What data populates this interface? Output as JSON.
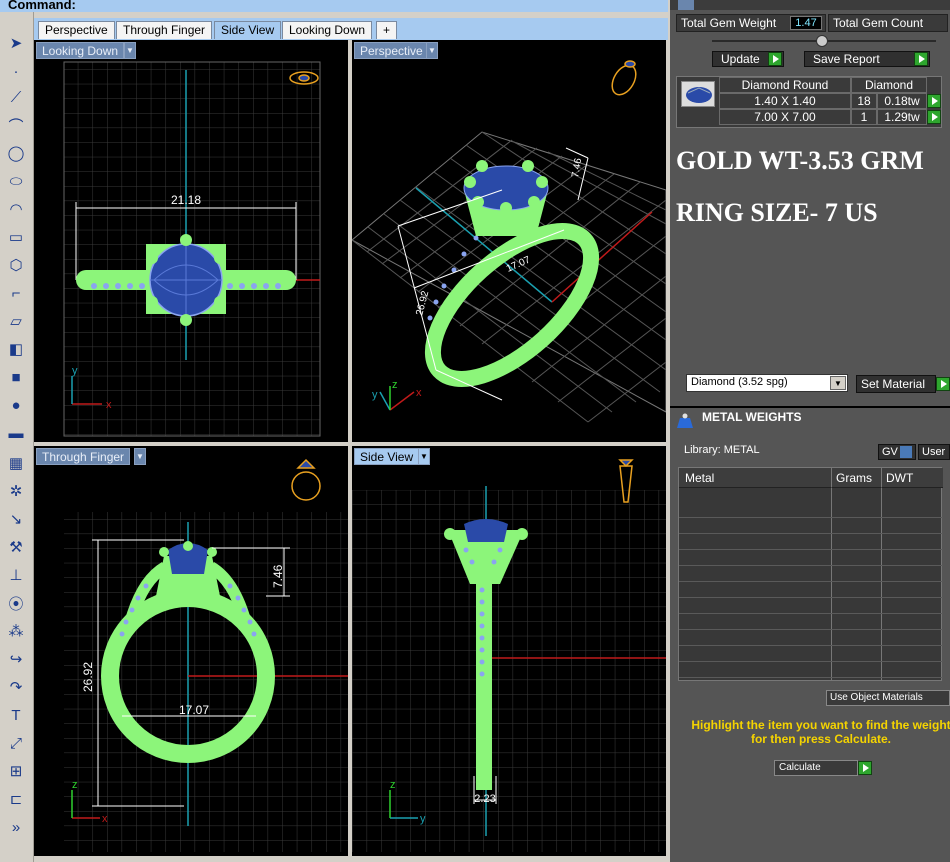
{
  "command": {
    "label": "Command:"
  },
  "tabs": [
    {
      "label": "Perspective"
    },
    {
      "label": "Through Finger"
    },
    {
      "label": "Side View"
    },
    {
      "label": "Looking Down"
    },
    {
      "label": "+"
    }
  ],
  "viewports": {
    "top_left": {
      "title": "Looking Down",
      "dim_width": "21.18",
      "axis_y": "y",
      "axis_x": "x"
    },
    "top_right": {
      "title": "Perspective",
      "dim_height": "7.46",
      "dim_width": "17.07",
      "dim_tall": "26.92",
      "axis_z": "z",
      "axis_y": "y",
      "axis_x": "x"
    },
    "bottom_left": {
      "title": "Through Finger",
      "dim_top": "7.46",
      "dim_height": "26.92",
      "dim_width": "17.07",
      "axis_z": "z",
      "axis_x": "x"
    },
    "bottom_right": {
      "title": "Side View",
      "dim_width": "2.23",
      "axis_z": "z",
      "axis_y": "y"
    }
  },
  "gem_summary": {
    "total_weight_label": "Total Gem Weight",
    "total_weight_value": "1.47",
    "total_count_label": "Total Gem Count",
    "update_label": "Update",
    "save_report_label": "Save Report"
  },
  "gem_table": {
    "headers": [
      "Diamond Round",
      "Diamond"
    ],
    "rows": [
      {
        "size": "1.40 X 1.40",
        "count": "18",
        "weight": "0.18tw"
      },
      {
        "size": "7.00 X 7.00",
        "count": "1",
        "weight": "1.29tw"
      }
    ]
  },
  "notes": {
    "gold_weight": "GOLD WT-3.53 GRM",
    "ring_size": "RING SIZE- 7 US"
  },
  "material": {
    "selected": "Diamond      (3.52 spg)",
    "set_material_label": "Set Material"
  },
  "metal_weights": {
    "title": "METAL WEIGHTS",
    "library_label": "Library: METAL",
    "gv_label": "GV",
    "user_label": "User",
    "columns": [
      "Metal",
      "Grams",
      "DWT"
    ],
    "use_object_materials_label": "Use Object Materials",
    "instruction": "Highlight the item you want to find the weight for then press Calculate.",
    "calculate_label": "Calculate"
  },
  "colors": {
    "accent_tab": "#a6caf0",
    "metal_green": "#8cf57a",
    "gem_blue": "#2a4aa8",
    "prong_blue": "#8aa4f0",
    "panel_bg": "#555555",
    "value_cyan": "#7fe7ff",
    "instruction_yellow": "#f5d400"
  }
}
